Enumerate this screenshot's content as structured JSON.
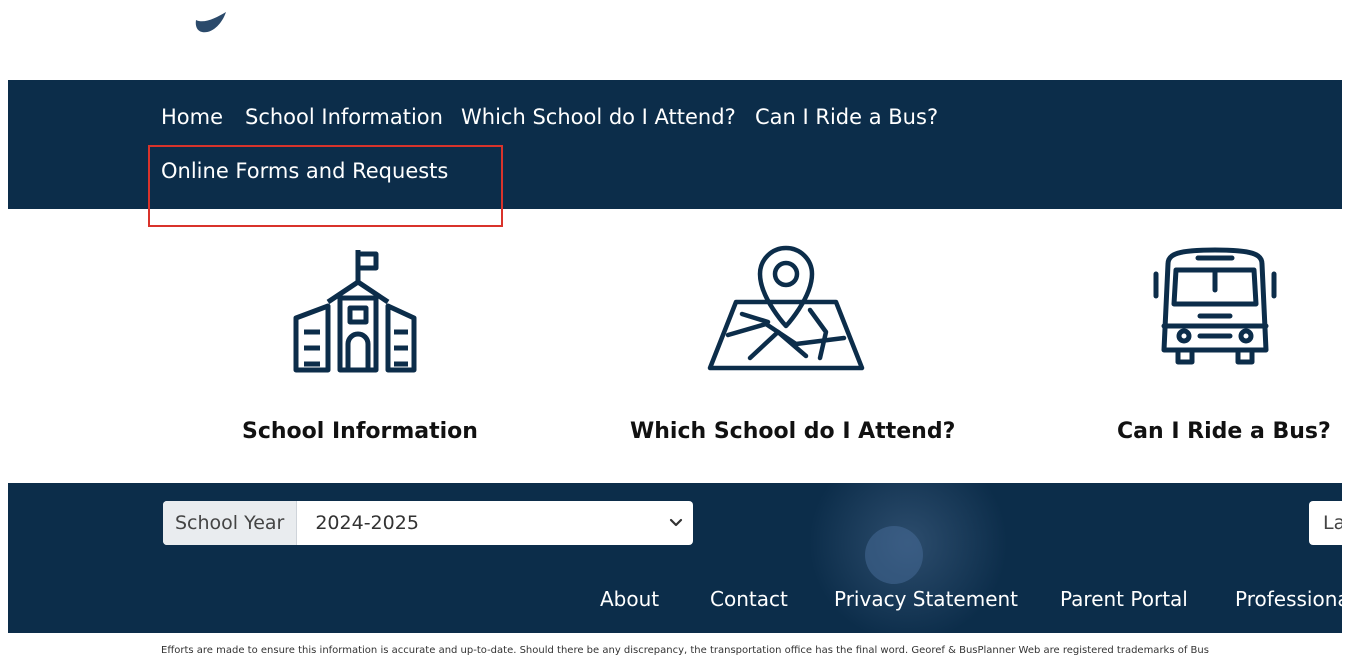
{
  "nav": {
    "items": [
      "Home",
      "School Information",
      "Which School do I Attend?",
      "Can I Ride a Bus?"
    ],
    "online_forms": "Online Forms and Requests"
  },
  "cards": [
    {
      "title": "School Information",
      "icon": "school-building-icon"
    },
    {
      "title": "Which School do I Attend?",
      "icon": "map-pin-icon"
    },
    {
      "title": "Can I Ride a Bus?",
      "icon": "school-bus-icon"
    }
  ],
  "footer": {
    "school_year_label": "School Year",
    "school_year_value": "2024-2025",
    "language_button": "La",
    "links": [
      "About",
      "Contact",
      "Privacy Statement",
      "Parent Portal",
      "Professiona"
    ],
    "disclaimer": "Efforts are made to ensure this information is accurate and up-to-date. Should there be any discrepancy, the transportation office has the final word. Georef & BusPlanner Web are registered trademarks of Bus"
  },
  "colors": {
    "navbar": "#0c2d4a",
    "highlight": "#d9332b",
    "icon_stroke": "#0c2d4a"
  }
}
